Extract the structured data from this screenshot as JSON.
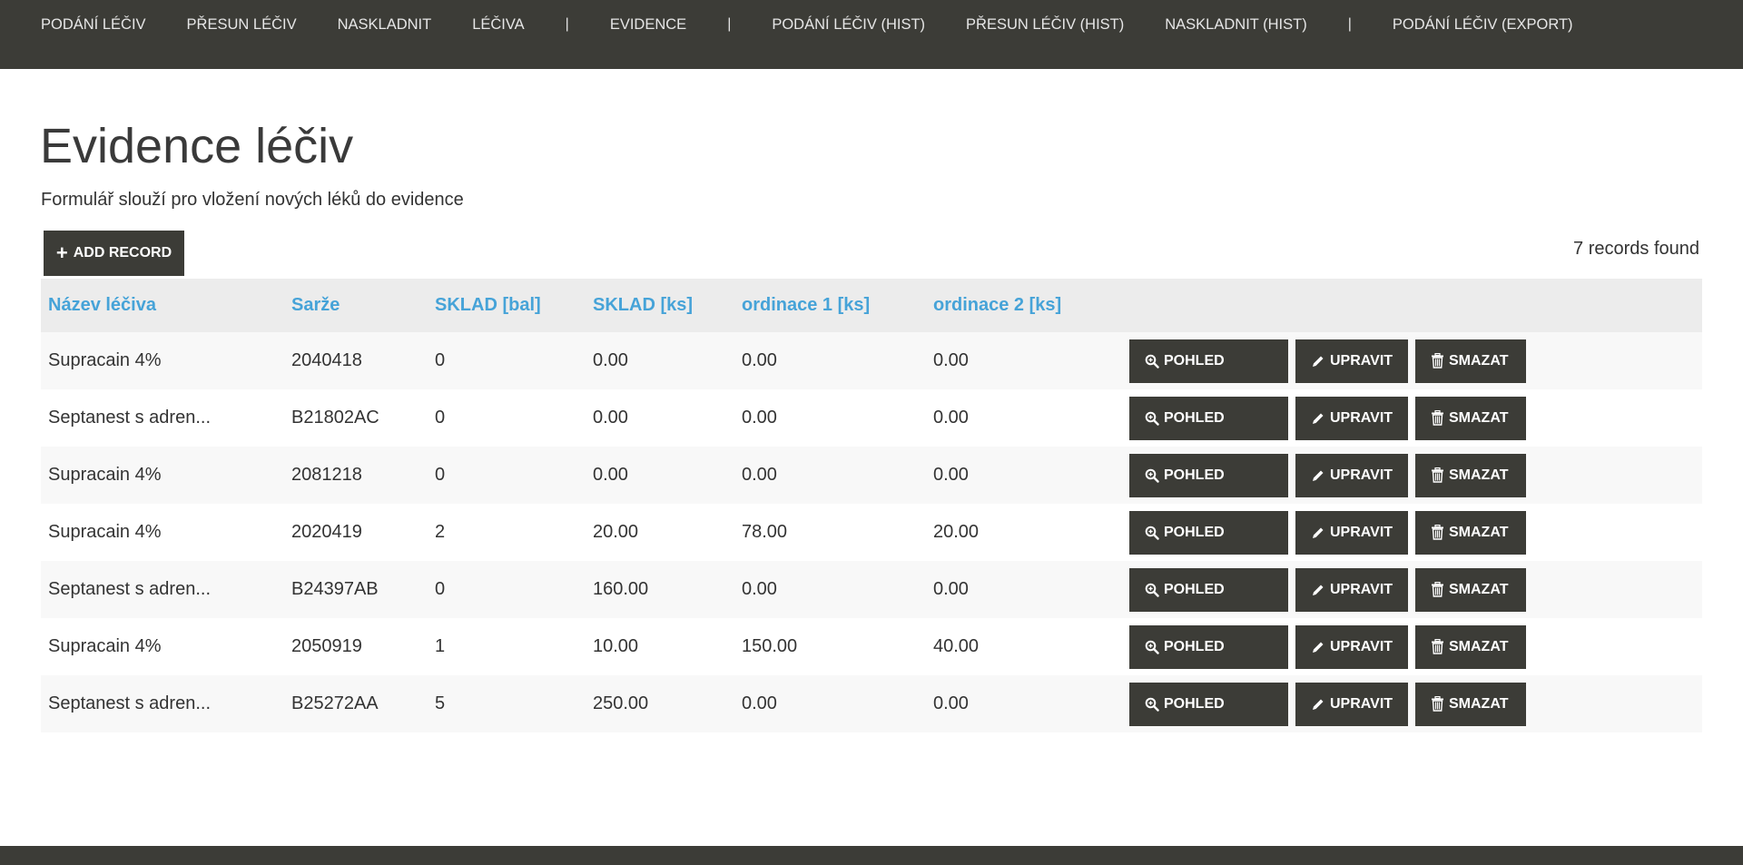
{
  "nav": {
    "items": [
      {
        "type": "link",
        "label": "PODÁNÍ LÉČIV"
      },
      {
        "type": "link",
        "label": "PŘESUN LÉČIV"
      },
      {
        "type": "link",
        "label": "NASKLADNIT"
      },
      {
        "type": "link",
        "label": "LÉČIVA"
      },
      {
        "type": "sep",
        "label": "|"
      },
      {
        "type": "link",
        "label": "EVIDENCE"
      },
      {
        "type": "sep",
        "label": "|"
      },
      {
        "type": "link",
        "label": "PODÁNÍ LÉČIV (HIST)"
      },
      {
        "type": "link",
        "label": "PŘESUN LÉČIV (HIST)"
      },
      {
        "type": "link",
        "label": "NASKLADNIT (HIST)"
      },
      {
        "type": "sep",
        "label": "|"
      },
      {
        "type": "link",
        "label": "PODÁNÍ LÉČIV (EXPORT)"
      }
    ]
  },
  "page": {
    "title": "Evidence léčiv",
    "subtitle": "Formulář slouží pro vložení nových léků do evidence",
    "add_record_label": "ADD RECORD",
    "records_found": "7 records found"
  },
  "table": {
    "columns": [
      "Název léčiva",
      "Sarže",
      "SKLAD [bal]",
      "SKLAD [ks]",
      "ordinace 1 [ks]",
      "ordinace 2 [ks]"
    ],
    "rows": [
      [
        "Supracain 4%",
        "2040418",
        "0",
        "0.00",
        "0.00",
        "0.00"
      ],
      [
        "Septanest s adren...",
        "B21802AC",
        "0",
        "0.00",
        "0.00",
        "0.00"
      ],
      [
        "Supracain 4%",
        "2081218",
        "0",
        "0.00",
        "0.00",
        "0.00"
      ],
      [
        "Supracain 4%",
        "2020419",
        "2",
        "20.00",
        "78.00",
        "20.00"
      ],
      [
        "Septanest s adren...",
        "B24397AB",
        "0",
        "160.00",
        "0.00",
        "0.00"
      ],
      [
        "Supracain 4%",
        "2050919",
        "1",
        "10.00",
        "150.00",
        "40.00"
      ],
      [
        "Septanest s adren...",
        "B25272AA",
        "5",
        "250.00",
        "0.00",
        "0.00"
      ]
    ],
    "actions": {
      "view": "POHLED",
      "edit": "UPRAVIT",
      "delete": "SMAZAT"
    }
  },
  "icons": {
    "add": "plus-icon",
    "view": "zoom-icon",
    "edit": "pencil-icon",
    "delete": "trash-icon"
  },
  "colors": {
    "nav_background": "#3c3c37",
    "header_text": "#46a3d8",
    "button_background": "#3c3c37",
    "row_stripe": "#f8f8f8",
    "table_header_background": "#ececec"
  }
}
